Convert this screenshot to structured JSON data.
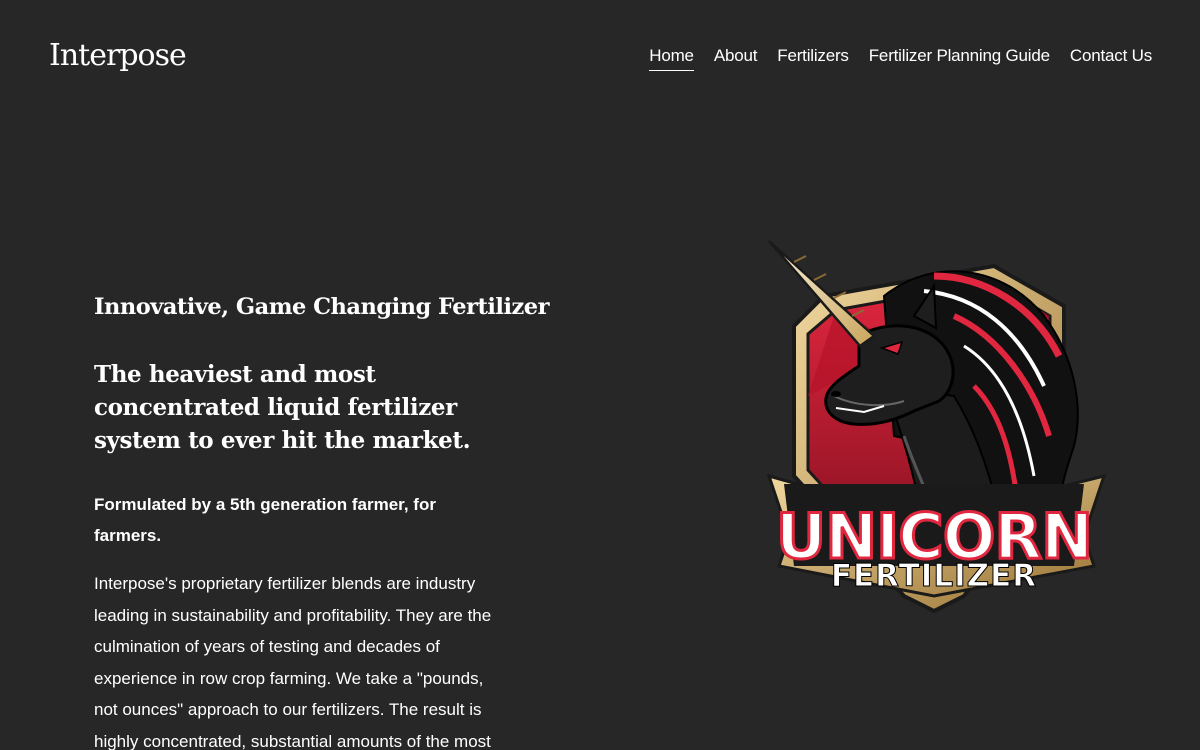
{
  "site": {
    "logo": "Interpose"
  },
  "nav": {
    "items": [
      {
        "label": "Home",
        "active": true
      },
      {
        "label": "About"
      },
      {
        "label": "Fertilizers"
      },
      {
        "label": "Fertilizer Planning Guide"
      },
      {
        "label": "Contact Us"
      }
    ]
  },
  "hero": {
    "headline_1": "Innovative, Game Changing Fertilizer",
    "headline_2": "The heaviest and most concentrated liquid fertilizer system to ever hit the market.",
    "tagline": "Formulated by a 5th generation farmer, for farmers.",
    "body": "Interpose's proprietary fertilizer blends are industry leading in sustainability and profitability. They are the culmination of years of testing and decades of experience in row crop farming. We take a \"pounds, not ounces\" approach to our fertilizers. The result is highly concentrated, substantial amounts of the most"
  },
  "brand_image": {
    "line_1": "UNICORN",
    "line_2": "FERTILIZER"
  },
  "colors": {
    "background": "#282728",
    "text": "#ffffff",
    "shield_red": "#c8102e",
    "gold": "#c9a45c"
  }
}
